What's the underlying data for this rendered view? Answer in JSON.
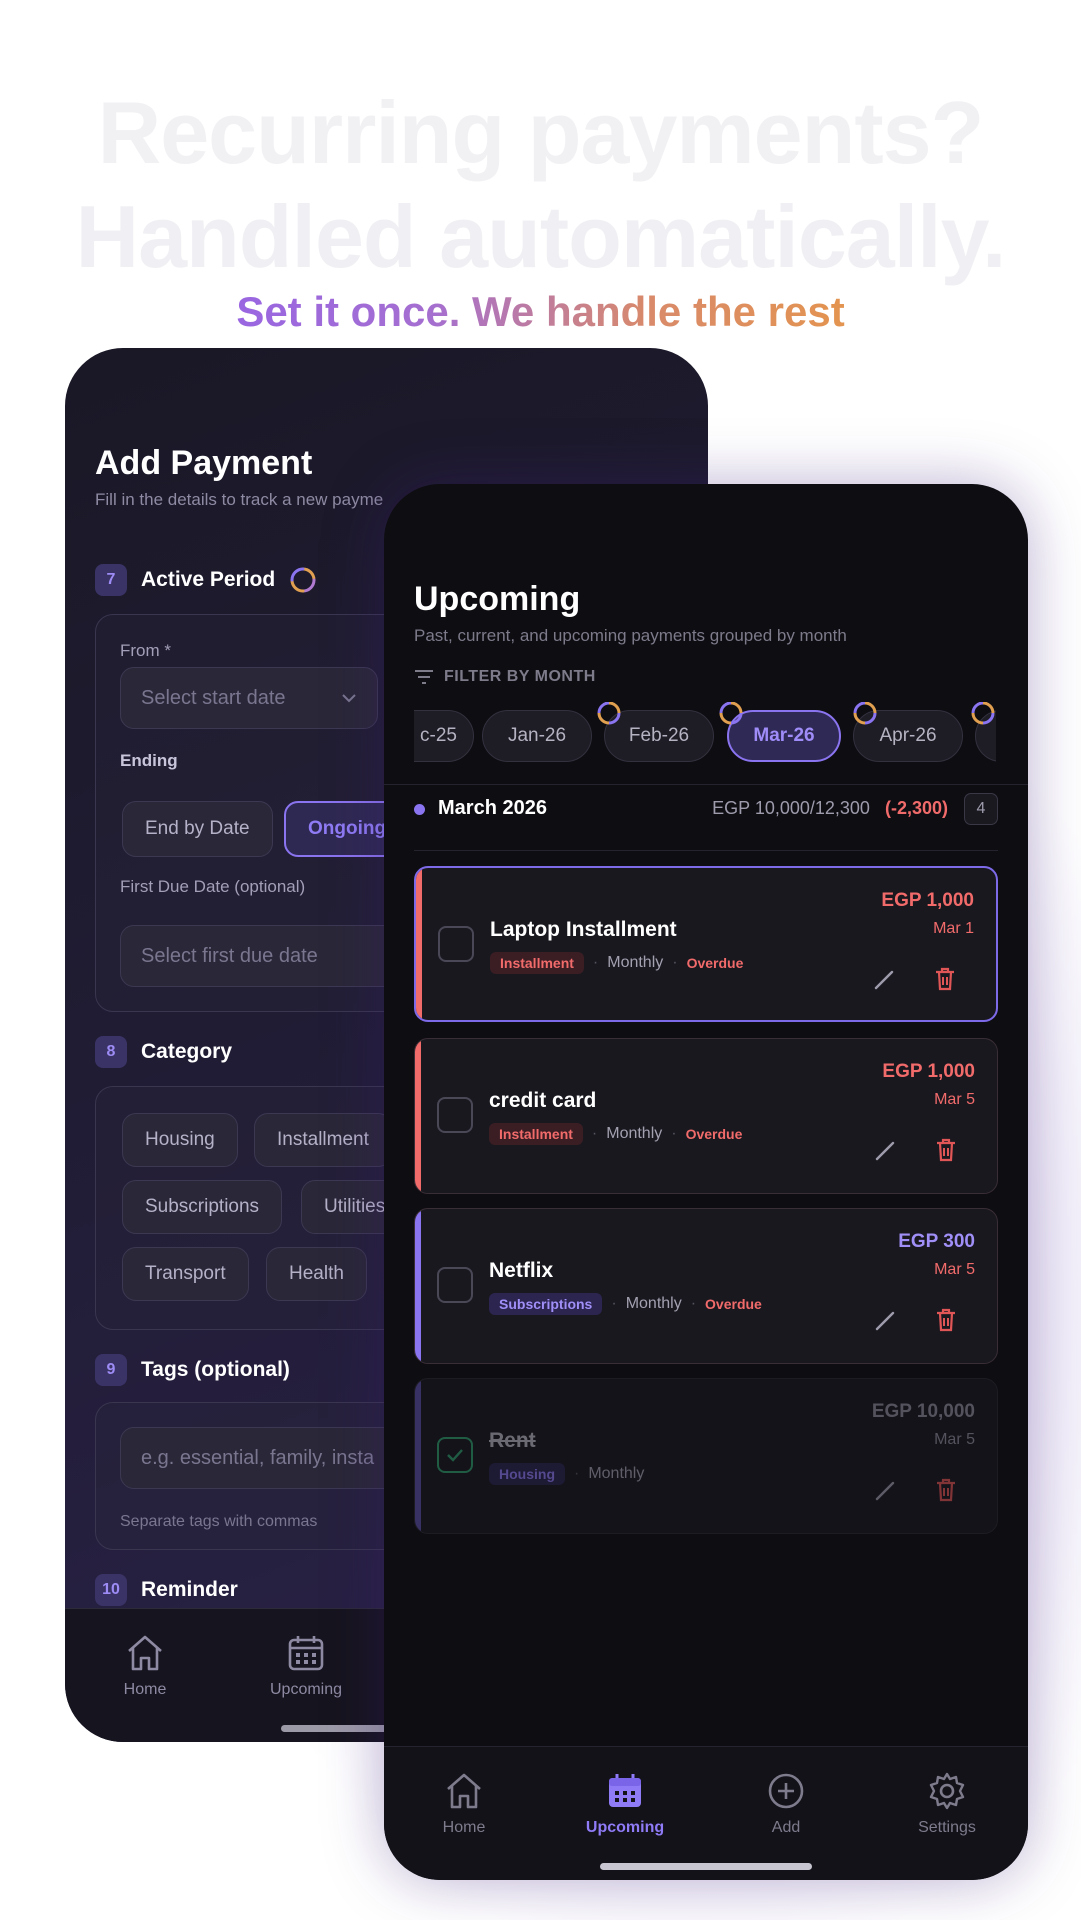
{
  "hero": {
    "line1": "Recurring payments?",
    "line2": "Handled automatically.",
    "tagline": "Set it once. We handle the rest"
  },
  "add_payment": {
    "title": "Add Payment",
    "subtitle": "Fill in the details to track a new payme",
    "steps": {
      "active_period": {
        "num": "7",
        "label": "Active Period"
      },
      "category": {
        "num": "8",
        "label": "Category"
      },
      "tags": {
        "num": "9",
        "label": "Tags (optional)"
      },
      "reminder": {
        "num": "10",
        "label": "Reminder"
      }
    },
    "from_label": "From *",
    "from_placeholder": "Select start date",
    "ending_label": "Ending",
    "ending_options": [
      "End by Date",
      "Ongoing"
    ],
    "first_due_label": "First Due Date (optional)",
    "first_due_placeholder": "Select first due date",
    "categories": [
      "Housing",
      "Installment",
      "Subscriptions",
      "Utilities",
      "Transport",
      "Health"
    ],
    "tags_placeholder": "e.g. essential, family, insta",
    "tags_hint": "Separate tags with commas",
    "nav": [
      "Home",
      "Upcoming"
    ]
  },
  "upcoming": {
    "title": "Upcoming",
    "subtitle": "Past, current, and upcoming payments grouped by month",
    "filter_label": "FILTER BY MONTH",
    "months": [
      "c-25",
      "Jan-26",
      "Feb-26",
      "Mar-26",
      "Apr-26"
    ],
    "selected_month": "Mar-26",
    "group": {
      "label": "March 2026",
      "amount": "EGP 10,000/12,300",
      "diff": "(-2,300)",
      "count": "4"
    },
    "payments": [
      {
        "name": "Laptop Installment",
        "tag": "Installment",
        "frequency": "Monthly",
        "status": "Overdue",
        "amount": "EGP 1,000",
        "date": "Mar 1"
      },
      {
        "name": "credit card",
        "tag": "Installment",
        "frequency": "Monthly",
        "status": "Overdue",
        "amount": "EGP 1,000",
        "date": "Mar 5"
      },
      {
        "name": "Netflix",
        "tag": "Subscriptions",
        "frequency": "Monthly",
        "status": "Overdue",
        "amount": "EGP 300",
        "date": "Mar 5"
      },
      {
        "name": "Rent",
        "tag": "Housing",
        "frequency": "Monthly",
        "status": "",
        "amount": "EGP 10,000",
        "date": "Mar 5"
      }
    ],
    "nav": [
      "Home",
      "Upcoming",
      "Add",
      "Settings"
    ],
    "active_nav": "Upcoming"
  },
  "colors": {
    "accent": "#8b74f0",
    "overdue": "#f26b6b",
    "paid": "#2f9e6e"
  }
}
